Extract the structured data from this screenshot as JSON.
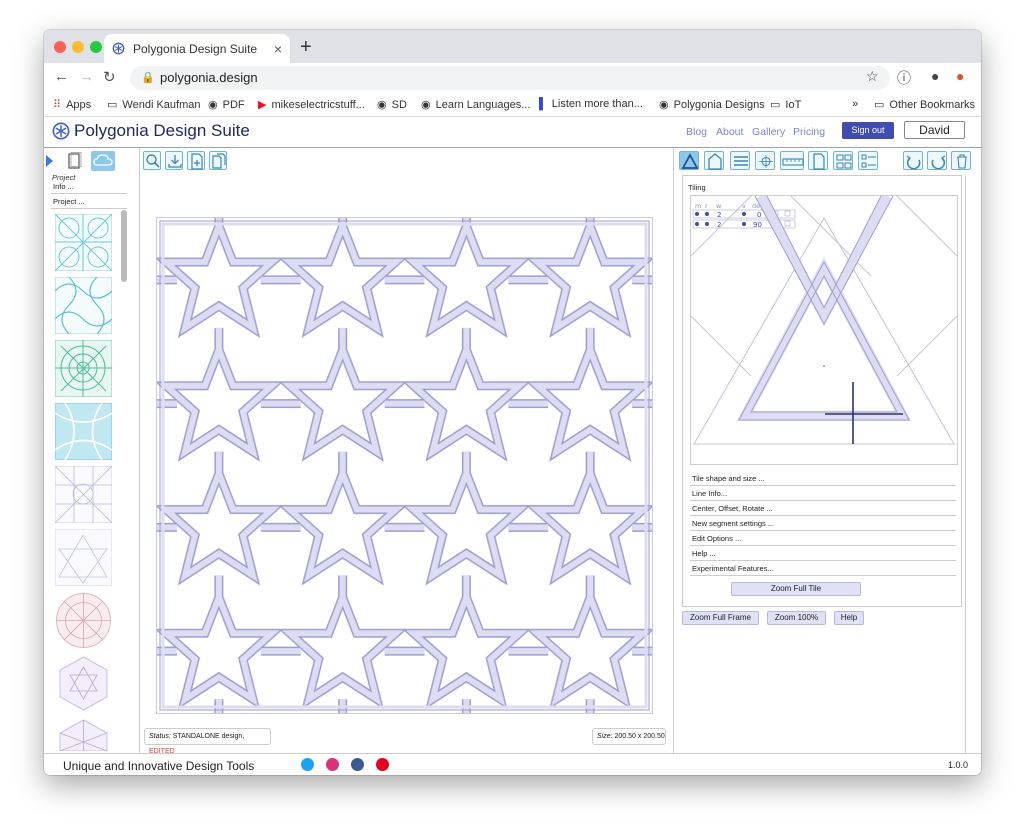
{
  "browser": {
    "tab_title": "Polygonia Design Suite",
    "tab_close": "×",
    "new_tab": "+",
    "url": "polygonia.design",
    "bookmarks": [
      "Apps",
      "Wendi Kaufman",
      "PDF",
      "mikeselectricstuff...",
      "SD",
      "Learn Languages...",
      "Listen more than...",
      "Polygonia Designs",
      "IoT"
    ],
    "more_bookmarks": "»",
    "other_bookmarks": "Other Bookmarks"
  },
  "app": {
    "title": "Polygonia Design Suite",
    "nav": [
      "Blog",
      "About",
      "Gallery",
      "Pricing"
    ],
    "signout": "Sign out",
    "user": "David"
  },
  "left": {
    "project_heading": "Project",
    "info": "Info ...",
    "project_menu": "Project ..."
  },
  "center": {
    "status_label": "Status:",
    "status_text": "STANDALONE design,",
    "status_flag": "EDITED",
    "size_label": "Size:",
    "size_value": "200.50 x 200.50"
  },
  "right": {
    "tiling_label": "Tiling",
    "table_headers": [
      "m",
      "r",
      "w",
      "v",
      "deg"
    ],
    "table_rows": [
      {
        "w": "2",
        "deg": "0"
      },
      {
        "w": "2",
        "deg": "90"
      }
    ],
    "menu": [
      "Tile shape and size ...",
      "Line Info...",
      "Center, Offset, Rotate ...",
      "New segment settings ...",
      "Edit Options ...",
      "Help ...",
      "Experimental Features..."
    ],
    "zoom_full_tile": "Zoom Full Tile",
    "zoom_full_frame": "Zoom Full Frame",
    "zoom_100": "Zoom 100%",
    "help": "Help"
  },
  "footer": {
    "tagline": "Unique and Innovative Design Tools",
    "version": "1.0.0"
  },
  "colors": {
    "pattern_fill": "#dcdcf2",
    "pattern_stroke": "#9c9ed0",
    "accent": "#3f4db0",
    "edited": "#e23b2e"
  }
}
